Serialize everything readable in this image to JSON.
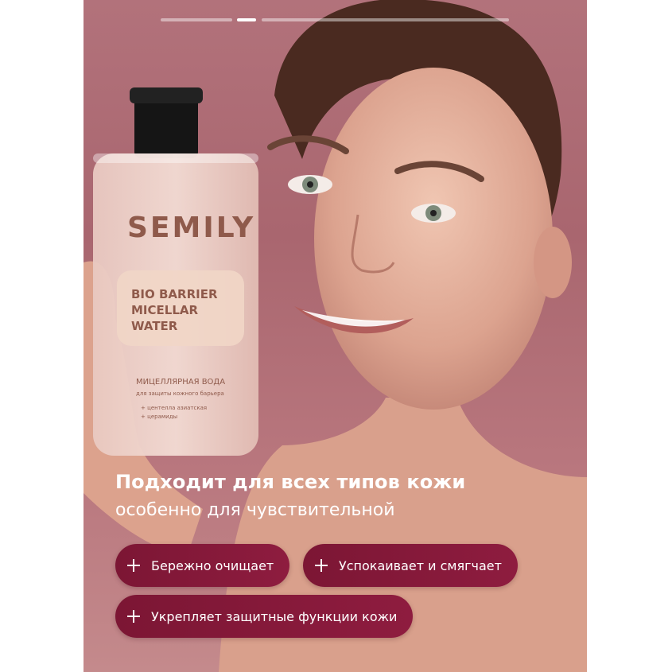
{
  "slider": {
    "segments": 3,
    "active_index": 1
  },
  "product": {
    "brand": "SEMILY",
    "name_line1": "BIO BARRIER",
    "name_line2": "MICELLAR",
    "name_line3": "WATER",
    "type": "МИЦЕЛЛЯРНАЯ ВОДА",
    "purpose": "для защиты кожного барьера",
    "ingredient1": "+ центелла азиатская",
    "ingredient2": "+ церамиды"
  },
  "headline": "Подходит для всех типов кожи",
  "subheadline": "особенно для чувствительной",
  "benefits": [
    {
      "label": "Бережно очищает"
    },
    {
      "label": "Успокаивает и смягчает"
    },
    {
      "label": "Укрепляет защитные функции кожи"
    }
  ],
  "colors": {
    "background": "#b2727b",
    "pill": "#8a1a3c",
    "text": "#ffffff"
  }
}
